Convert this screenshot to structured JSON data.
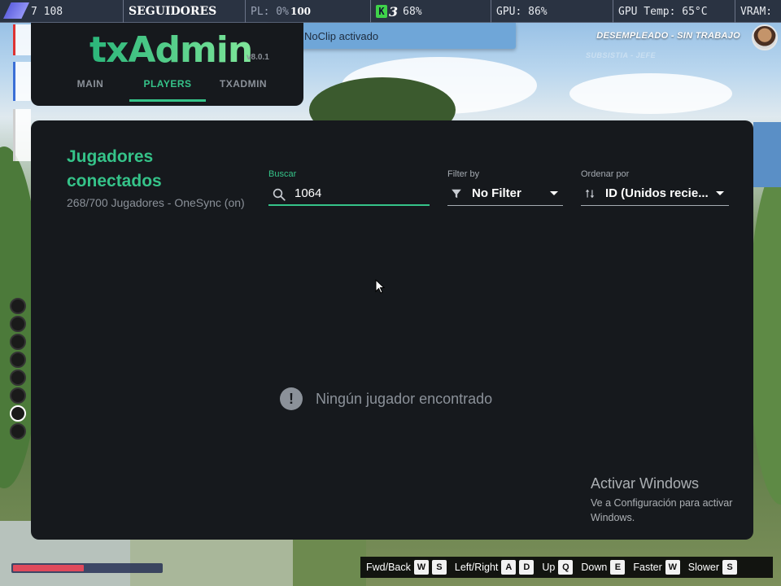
{
  "perf_overlay": {
    "fps_value": "7 108",
    "followers_label": "SEGUIDORES",
    "pl_label": "PL: 0%",
    "pl_value": "100",
    "ring_number": "3",
    "cpu_label": "68%",
    "gpu_label": "GPU: 86%",
    "gpu_temp_label": "GPU Temp: 65°C",
    "vram_label": "VRAM:"
  },
  "notification": {
    "text": "NoClip activado",
    "icon": "info-icon"
  },
  "hud": {
    "job_label": "DESEMPLEADO - SIN TRABAJO",
    "sub_label": "SUBSISTIA - JEFE",
    "health_percent": 48,
    "health_color": "#e04a5c"
  },
  "txadmin": {
    "logo": "txAdmin",
    "version": "v8.0.1",
    "tabs": [
      {
        "label": "MAIN",
        "active": false
      },
      {
        "label": "PLAYERS",
        "active": true
      },
      {
        "label": "TXADMIN",
        "active": false
      }
    ],
    "accent_color": "#35c389",
    "panel_bg": "#16191d"
  },
  "players": {
    "title": "Jugadores conectados",
    "subtitle": "268/700 Jugadores - OneSync (on)",
    "search": {
      "label": "Buscar",
      "value": "1064",
      "icon": "search-icon"
    },
    "filter": {
      "label": "Filter by",
      "value": "No Filter",
      "icon": "filter-icon"
    },
    "sort": {
      "label": "Ordenar por",
      "value": "ID (Unidos recie...",
      "icon": "sort-icon"
    },
    "empty_message": "Ningún jugador encontrado"
  },
  "watermark": {
    "title": "Activar Windows",
    "subtitle": "Ve a Configuración para activar Windows."
  },
  "keybinds": [
    {
      "label": "Fwd/Back",
      "keys": [
        "W",
        "S"
      ]
    },
    {
      "label": "Left/Right",
      "keys": [
        "A",
        "D"
      ]
    },
    {
      "label": "Up",
      "keys": [
        "Q"
      ]
    },
    {
      "label": "Down",
      "keys": [
        "E"
      ]
    },
    {
      "label": "Faster",
      "keys": [
        "W"
      ]
    },
    {
      "label": "Slower",
      "keys": [
        "S"
      ]
    }
  ]
}
